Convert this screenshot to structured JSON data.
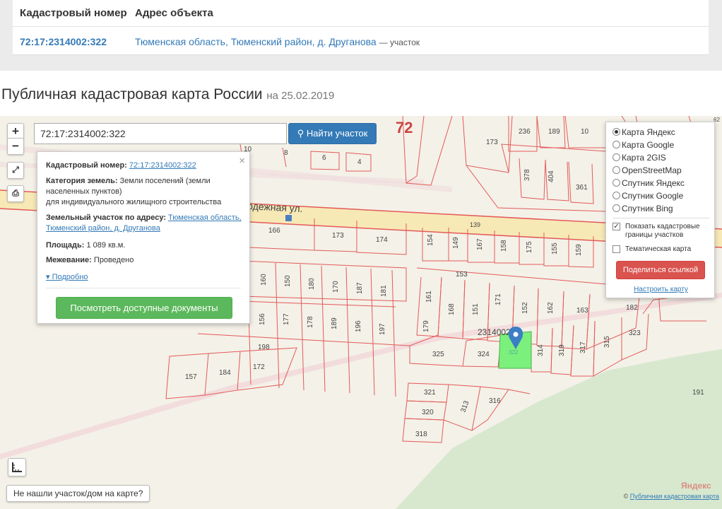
{
  "table": {
    "col_cadastral": "Кадастровый номер",
    "col_address": "Адрес объекта",
    "row": {
      "cadastral": "72:17:2314002:322",
      "address": "Тюменская область, Тюменский район, д. Друганова",
      "type": "— участок"
    }
  },
  "page": {
    "title": "Публичная кадастровая карта России",
    "date": "на 25.02.2019"
  },
  "map": {
    "zoom_in": "+",
    "zoom_out": "−",
    "search_value": "72:17:2314002:322",
    "search_button": "Найти участок",
    "quarter_label": "72",
    "street_label": "одежная ул.",
    "block_label": "2314002",
    "not_found": "Не нашли участок/дом на карте?",
    "copyright_prefix": "©",
    "copyright_link": "Публичная кадастровая карта",
    "yandex": "Яндекс"
  },
  "info": {
    "cad_label": "Кадастровый номер:",
    "cad_value": "72:17:2314002:322",
    "cat_label": "Категория земель:",
    "cat_value": "Земли поселений (земли населенных пунктов)",
    "cat_use": "для индивидуального жилищного строительства",
    "addr_label": "Земельный участок по адресу:",
    "addr_value": "Тюменская область, Тюменский район, д. Друганова",
    "area_label": "Площадь:",
    "area_value": "1 089 кв.м.",
    "survey_label": "Межевание:",
    "survey_value": "Проведено",
    "more": "Подробно",
    "docs_button": "Посмотреть доступные документы",
    "close": "×"
  },
  "layers": {
    "options": [
      {
        "label": "Карта Яндекс",
        "selected": true
      },
      {
        "label": "Карта Google",
        "selected": false
      },
      {
        "label": "Карта 2GIS",
        "selected": false
      },
      {
        "label": "OpenStreetMap",
        "selected": false
      },
      {
        "label": "Спутник Яндекс",
        "selected": false
      },
      {
        "label": "Спутник Google",
        "selected": false
      },
      {
        "label": "Спутник Bing",
        "selected": false
      }
    ],
    "show_borders": "Показать кадастровые границы участков",
    "thematic": "Тематическая карта",
    "share_button": "Поделиться ссылкой",
    "setup_link": "Настроить карту"
  },
  "parcels": {
    "labels": [
      "236",
      "189",
      "10",
      "62",
      "173",
      "8",
      "6",
      "4",
      "10",
      "378",
      "404",
      "361",
      "166",
      "173",
      "174",
      "139",
      "154",
      "149",
      "167",
      "158",
      "175",
      "155",
      "159",
      "153",
      "160",
      "150",
      "180",
      "170",
      "187",
      "181",
      "161",
      "168",
      "151",
      "171",
      "152",
      "162",
      "163",
      "182",
      "156",
      "177",
      "178",
      "189",
      "196",
      "197",
      "179",
      "323",
      "198",
      "325",
      "324",
      "322",
      "314",
      "319",
      "317",
      "315",
      "157",
      "184",
      "172",
      "321",
      "313",
      "316",
      "320",
      "318",
      "191",
      "1"
    ]
  },
  "colors": {
    "accent": "#337ab7",
    "parcel_border": "#e35a5a",
    "selected_parcel": "#7cf07c",
    "green_button": "#5cb85c",
    "red_button": "#d9534f"
  }
}
